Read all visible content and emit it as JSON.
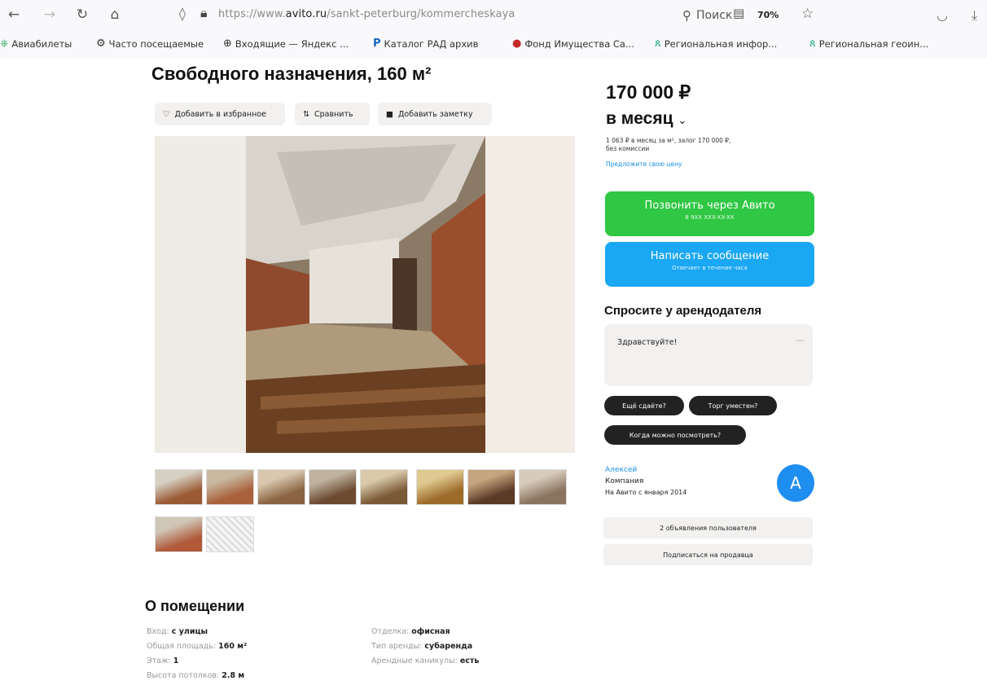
{
  "browser": {
    "url_prefix": "https://www.",
    "url_domain": "avito.ru",
    "url_rest": "/sankt-peterburg/kommercheskaya",
    "zoom": "70%",
    "search_placeholder": "Поиск",
    "bookmarks": [
      {
        "label": "Авиабилеты",
        "icon": "plane-icon"
      },
      {
        "label": "Часто посещаемые",
        "icon": "gear-icon"
      },
      {
        "label": "Входящие — Яндекс ...",
        "icon": "globe-icon"
      },
      {
        "label": "Каталог РАД архив",
        "icon": "rad-logo-icon"
      },
      {
        "label": "Фонд Имущества Са...",
        "icon": "fund-logo-icon"
      },
      {
        "label": "Региональная инфор...",
        "icon": "region-icon"
      },
      {
        "label": "Региональная геоин...",
        "icon": "region-icon"
      }
    ]
  },
  "listing": {
    "title": "Свободного назначения, 160 м²",
    "actions": {
      "favorite": "Добавить в избранное",
      "compare": "Сравнить",
      "note": "Добавить заметку"
    },
    "thumb_count": 10
  },
  "about": {
    "title": "О помещении",
    "left": [
      {
        "label": "Вход:",
        "value": "с улицы"
      },
      {
        "label": "Общая площадь:",
        "value": "160 м²"
      },
      {
        "label": "Этаж:",
        "value": "1"
      },
      {
        "label": "Высота потолков:",
        "value": "2.8 м"
      }
    ],
    "right": [
      {
        "label": "Отделка:",
        "value": "офисная"
      },
      {
        "label": "Тип аренды:",
        "value": "субаренда"
      },
      {
        "label": "Арендные каникулы:",
        "value": "есть"
      }
    ]
  },
  "sidebar": {
    "price": "170 000 ₽",
    "period": "в месяц",
    "details_line1": "1 063 ₽ в месяц за м², залог 170 000 ₽,",
    "details_line2": "без комиссии",
    "offer_link": "Предложите свою цену",
    "call_button": {
      "label": "Позвонить через Авито",
      "sub": "8 9XX XXX-XX-XX"
    },
    "message_button": {
      "label": "Написать сообщение",
      "sub": "Отвечает в течение часа"
    },
    "ask_title": "Спросите у арендодателя",
    "ask_text": "Здравствуйте!",
    "chips": [
      "Ещё сдаёте?",
      "Торг уместен?",
      "Когда можно посмотреть?"
    ],
    "seller": {
      "name": "Алексей",
      "type": "Компания",
      "since": "На Авито с января 2014",
      "avatar_letter": "A"
    },
    "seller_buttons": {
      "ads": "2 объявления пользователя",
      "subscribe": "Подписаться на продавца"
    }
  },
  "colors": {
    "call_green": "#2fc743",
    "message_blue": "#1aa7f3",
    "avatar_blue": "#1f8ef1",
    "link_blue": "#1a8fe6"
  }
}
